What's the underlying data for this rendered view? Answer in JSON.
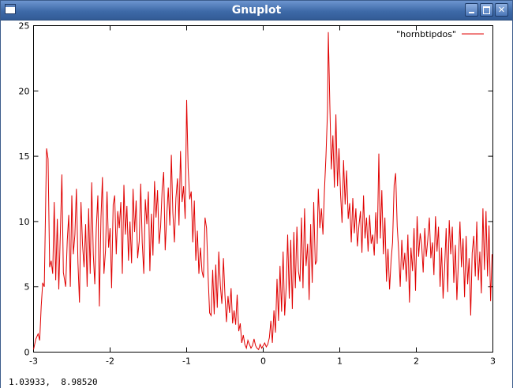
{
  "window": {
    "title": "Gnuplot",
    "controls": [
      "minimize-icon",
      "maximize-icon",
      "close-icon"
    ]
  },
  "status": {
    "coordinates": "1.03933,  8.98520"
  },
  "colors": {
    "series": "#e00000",
    "titlebar": "#3e6aa8"
  },
  "chart_data": {
    "type": "line",
    "title": "",
    "xlabel": "",
    "ylabel": "",
    "xlim": [
      -3,
      3
    ],
    "ylim": [
      0,
      25
    ],
    "xticks": [
      -3,
      -2,
      -1,
      0,
      1,
      2,
      3
    ],
    "yticks": [
      0,
      5,
      10,
      15,
      20,
      25
    ],
    "grid": false,
    "legend_position": "top-right",
    "series": [
      {
        "name": "\"hornbtipdos\"",
        "color": "#e00000",
        "points": [
          [
            -3.0,
            0.2
          ],
          [
            -2.97,
            1.0
          ],
          [
            -2.94,
            1.4
          ],
          [
            -2.92,
            0.9
          ],
          [
            -2.9,
            3.5
          ],
          [
            -2.88,
            5.3
          ],
          [
            -2.86,
            5.0
          ],
          [
            -2.83,
            15.6
          ],
          [
            -2.81,
            14.8
          ],
          [
            -2.79,
            6.5
          ],
          [
            -2.77,
            7.0
          ],
          [
            -2.75,
            6.0
          ],
          [
            -2.73,
            11.5
          ],
          [
            -2.71,
            5.5
          ],
          [
            -2.69,
            10.2
          ],
          [
            -2.67,
            4.8
          ],
          [
            -2.65,
            9.2
          ],
          [
            -2.63,
            13.6
          ],
          [
            -2.61,
            6.1
          ],
          [
            -2.58,
            5.0
          ],
          [
            -2.56,
            8.5
          ],
          [
            -2.54,
            10.5
          ],
          [
            -2.52,
            5.0
          ],
          [
            -2.5,
            12.0
          ],
          [
            -2.48,
            7.5
          ],
          [
            -2.46,
            9.0
          ],
          [
            -2.44,
            12.5
          ],
          [
            -2.42,
            6.8
          ],
          [
            -2.4,
            3.8
          ],
          [
            -2.38,
            11.5
          ],
          [
            -2.36,
            8.2
          ],
          [
            -2.34,
            6.5
          ],
          [
            -2.32,
            9.8
          ],
          [
            -2.3,
            5.0
          ],
          [
            -2.28,
            11.0
          ],
          [
            -2.26,
            6.0
          ],
          [
            -2.24,
            13.0
          ],
          [
            -2.22,
            7.5
          ],
          [
            -2.2,
            5.2
          ],
          [
            -2.18,
            9.5
          ],
          [
            -2.16,
            12.0
          ],
          [
            -2.14,
            3.5
          ],
          [
            -2.12,
            10.2
          ],
          [
            -2.1,
            13.4
          ],
          [
            -2.08,
            6.0
          ],
          [
            -2.06,
            7.8
          ],
          [
            -2.04,
            12.3
          ],
          [
            -2.02,
            8.0
          ],
          [
            -2.0,
            9.5
          ],
          [
            -1.98,
            4.9
          ],
          [
            -1.96,
            11.3
          ],
          [
            -1.94,
            12.0
          ],
          [
            -1.92,
            7.5
          ],
          [
            -1.9,
            10.8
          ],
          [
            -1.88,
            9.5
          ],
          [
            -1.86,
            11.5
          ],
          [
            -1.84,
            6.0
          ],
          [
            -1.82,
            12.8
          ],
          [
            -1.8,
            9.0
          ],
          [
            -1.78,
            11.2
          ],
          [
            -1.76,
            7.0
          ],
          [
            -1.74,
            10.0
          ],
          [
            -1.72,
            6.8
          ],
          [
            -1.7,
            12.5
          ],
          [
            -1.68,
            9.2
          ],
          [
            -1.66,
            11.6
          ],
          [
            -1.64,
            7.2
          ],
          [
            -1.62,
            8.5
          ],
          [
            -1.6,
            12.9
          ],
          [
            -1.58,
            8.4
          ],
          [
            -1.56,
            6.0
          ],
          [
            -1.54,
            11.7
          ],
          [
            -1.52,
            9.8
          ],
          [
            -1.5,
            12.3
          ],
          [
            -1.48,
            6.2
          ],
          [
            -1.46,
            10.6
          ],
          [
            -1.44,
            7.4
          ],
          [
            -1.42,
            13.1
          ],
          [
            -1.4,
            10.3
          ],
          [
            -1.38,
            12.4
          ],
          [
            -1.36,
            8.3
          ],
          [
            -1.34,
            9.6
          ],
          [
            -1.32,
            12.5
          ],
          [
            -1.3,
            13.8
          ],
          [
            -1.28,
            7.8
          ],
          [
            -1.26,
            10.4
          ],
          [
            -1.24,
            12.6
          ],
          [
            -1.22,
            9.7
          ],
          [
            -1.2,
            15.1
          ],
          [
            -1.18,
            10.7
          ],
          [
            -1.16,
            8.4
          ],
          [
            -1.14,
            11.8
          ],
          [
            -1.12,
            13.3
          ],
          [
            -1.1,
            9.7
          ],
          [
            -1.08,
            15.4
          ],
          [
            -1.06,
            11.5
          ],
          [
            -1.04,
            12.7
          ],
          [
            -1.02,
            10.2
          ],
          [
            -1.0,
            19.3
          ],
          [
            -0.98,
            14.1
          ],
          [
            -0.96,
            11.7
          ],
          [
            -0.94,
            12.3
          ],
          [
            -0.92,
            8.4
          ],
          [
            -0.9,
            11.6
          ],
          [
            -0.88,
            7.0
          ],
          [
            -0.86,
            9.3
          ],
          [
            -0.84,
            6.0
          ],
          [
            -0.82,
            8.0
          ],
          [
            -0.8,
            6.2
          ],
          [
            -0.78,
            5.7
          ],
          [
            -0.76,
            10.3
          ],
          [
            -0.74,
            9.5
          ],
          [
            -0.72,
            5.8
          ],
          [
            -0.7,
            3.0
          ],
          [
            -0.68,
            2.8
          ],
          [
            -0.66,
            6.3
          ],
          [
            -0.64,
            2.9
          ],
          [
            -0.62,
            6.7
          ],
          [
            -0.6,
            3.4
          ],
          [
            -0.58,
            7.7
          ],
          [
            -0.56,
            5.1
          ],
          [
            -0.54,
            3.7
          ],
          [
            -0.52,
            7.2
          ],
          [
            -0.5,
            4.4
          ],
          [
            -0.48,
            2.3
          ],
          [
            -0.46,
            4.3
          ],
          [
            -0.44,
            3.0
          ],
          [
            -0.42,
            4.9
          ],
          [
            -0.4,
            2.2
          ],
          [
            -0.38,
            3.2
          ],
          [
            -0.36,
            2.1
          ],
          [
            -0.34,
            4.4
          ],
          [
            -0.32,
            1.6
          ],
          [
            -0.3,
            2.2
          ],
          [
            -0.28,
            0.7
          ],
          [
            -0.26,
            1.3
          ],
          [
            -0.24,
            0.6
          ],
          [
            -0.22,
            0.3
          ],
          [
            -0.2,
            0.9
          ],
          [
            -0.18,
            0.6
          ],
          [
            -0.16,
            0.3
          ],
          [
            -0.14,
            0.5
          ],
          [
            -0.12,
            1.0
          ],
          [
            -0.1,
            0.5
          ],
          [
            -0.08,
            0.3
          ],
          [
            -0.06,
            0.2
          ],
          [
            -0.04,
            0.6
          ],
          [
            -0.02,
            0.3
          ],
          [
            0.0,
            0.5
          ],
          [
            0.02,
            0.7
          ],
          [
            0.04,
            0.4
          ],
          [
            0.06,
            0.6
          ],
          [
            0.08,
            1.1
          ],
          [
            0.1,
            2.4
          ],
          [
            0.12,
            0.7
          ],
          [
            0.14,
            3.2
          ],
          [
            0.16,
            1.5
          ],
          [
            0.18,
            5.6
          ],
          [
            0.2,
            2.4
          ],
          [
            0.22,
            6.6
          ],
          [
            0.24,
            3.1
          ],
          [
            0.26,
            7.7
          ],
          [
            0.28,
            2.8
          ],
          [
            0.3,
            5.0
          ],
          [
            0.32,
            9.0
          ],
          [
            0.34,
            4.1
          ],
          [
            0.36,
            8.6
          ],
          [
            0.38,
            3.3
          ],
          [
            0.4,
            9.2
          ],
          [
            0.42,
            4.9
          ],
          [
            0.44,
            9.6
          ],
          [
            0.46,
            6.2
          ],
          [
            0.48,
            5.4
          ],
          [
            0.5,
            10.3
          ],
          [
            0.52,
            4.9
          ],
          [
            0.54,
            11.0
          ],
          [
            0.56,
            6.6
          ],
          [
            0.58,
            8.3
          ],
          [
            0.6,
            4.0
          ],
          [
            0.62,
            9.8
          ],
          [
            0.64,
            5.3
          ],
          [
            0.66,
            11.5
          ],
          [
            0.68,
            6.7
          ],
          [
            0.7,
            7.0
          ],
          [
            0.72,
            12.5
          ],
          [
            0.74,
            9.5
          ],
          [
            0.76,
            11.0
          ],
          [
            0.78,
            9.0
          ],
          [
            0.8,
            12.4
          ],
          [
            0.82,
            15.0
          ],
          [
            0.84,
            18.5
          ],
          [
            0.85,
            24.5
          ],
          [
            0.87,
            19.0
          ],
          [
            0.89,
            14.0
          ],
          [
            0.91,
            16.6
          ],
          [
            0.93,
            12.6
          ],
          [
            0.95,
            18.2
          ],
          [
            0.97,
            12.7
          ],
          [
            0.99,
            15.6
          ],
          [
            1.01,
            12.1
          ],
          [
            1.03,
            9.9
          ],
          [
            1.05,
            14.7
          ],
          [
            1.07,
            11.3
          ],
          [
            1.09,
            13.9
          ],
          [
            1.11,
            10.2
          ],
          [
            1.13,
            11.4
          ],
          [
            1.15,
            8.4
          ],
          [
            1.17,
            11.8
          ],
          [
            1.19,
            9.1
          ],
          [
            1.21,
            11.0
          ],
          [
            1.23,
            8.1
          ],
          [
            1.25,
            9.7
          ],
          [
            1.27,
            10.8
          ],
          [
            1.29,
            7.6
          ],
          [
            1.31,
            12.0
          ],
          [
            1.33,
            8.7
          ],
          [
            1.35,
            10.3
          ],
          [
            1.37,
            7.7
          ],
          [
            1.39,
            10.5
          ],
          [
            1.41,
            8.3
          ],
          [
            1.43,
            9.0
          ],
          [
            1.45,
            7.4
          ],
          [
            1.47,
            10.7
          ],
          [
            1.49,
            8.3
          ],
          [
            1.51,
            15.2
          ],
          [
            1.53,
            8.7
          ],
          [
            1.55,
            12.4
          ],
          [
            1.57,
            7.5
          ],
          [
            1.59,
            10.3
          ],
          [
            1.61,
            5.4
          ],
          [
            1.63,
            7.9
          ],
          [
            1.65,
            4.8
          ],
          [
            1.67,
            7.0
          ],
          [
            1.69,
            8.4
          ],
          [
            1.71,
            12.8
          ],
          [
            1.73,
            13.7
          ],
          [
            1.75,
            9.6
          ],
          [
            1.77,
            7.7
          ],
          [
            1.79,
            5.0
          ],
          [
            1.81,
            8.6
          ],
          [
            1.83,
            6.3
          ],
          [
            1.85,
            7.6
          ],
          [
            1.87,
            5.4
          ],
          [
            1.89,
            9.0
          ],
          [
            1.91,
            3.8
          ],
          [
            1.93,
            8.0
          ],
          [
            1.95,
            6.2
          ],
          [
            1.97,
            9.5
          ],
          [
            1.99,
            4.7
          ],
          [
            2.01,
            10.4
          ],
          [
            2.03,
            7.3
          ],
          [
            2.05,
            9.1
          ],
          [
            2.07,
            8.2
          ],
          [
            2.09,
            6.1
          ],
          [
            2.11,
            9.5
          ],
          [
            2.13,
            7.3
          ],
          [
            2.15,
            8.6
          ],
          [
            2.17,
            10.3
          ],
          [
            2.19,
            7.2
          ],
          [
            2.21,
            8.4
          ],
          [
            2.23,
            5.9
          ],
          [
            2.25,
            10.4
          ],
          [
            2.27,
            7.7
          ],
          [
            2.29,
            9.6
          ],
          [
            2.31,
            5.0
          ],
          [
            2.33,
            8.0
          ],
          [
            2.35,
            4.1
          ],
          [
            2.37,
            6.5
          ],
          [
            2.39,
            9.5
          ],
          [
            2.41,
            4.6
          ],
          [
            2.43,
            10.1
          ],
          [
            2.45,
            7.5
          ],
          [
            2.47,
            9.6
          ],
          [
            2.49,
            5.3
          ],
          [
            2.51,
            8.2
          ],
          [
            2.53,
            4.0
          ],
          [
            2.55,
            6.9
          ],
          [
            2.57,
            10.0
          ],
          [
            2.59,
            6.5
          ],
          [
            2.61,
            8.7
          ],
          [
            2.63,
            4.2
          ],
          [
            2.65,
            8.9
          ],
          [
            2.67,
            5.2
          ],
          [
            2.69,
            7.2
          ],
          [
            2.71,
            2.8
          ],
          [
            2.73,
            7.6
          ],
          [
            2.75,
            8.9
          ],
          [
            2.77,
            5.8
          ],
          [
            2.79,
            10.0
          ],
          [
            2.81,
            5.5
          ],
          [
            2.83,
            7.7
          ],
          [
            2.85,
            4.5
          ],
          [
            2.87,
            11.0
          ],
          [
            2.89,
            6.3
          ],
          [
            2.91,
            10.8
          ],
          [
            2.93,
            5.8
          ],
          [
            2.95,
            9.7
          ],
          [
            2.97,
            3.9
          ],
          [
            2.99,
            7.5
          ]
        ]
      }
    ]
  }
}
